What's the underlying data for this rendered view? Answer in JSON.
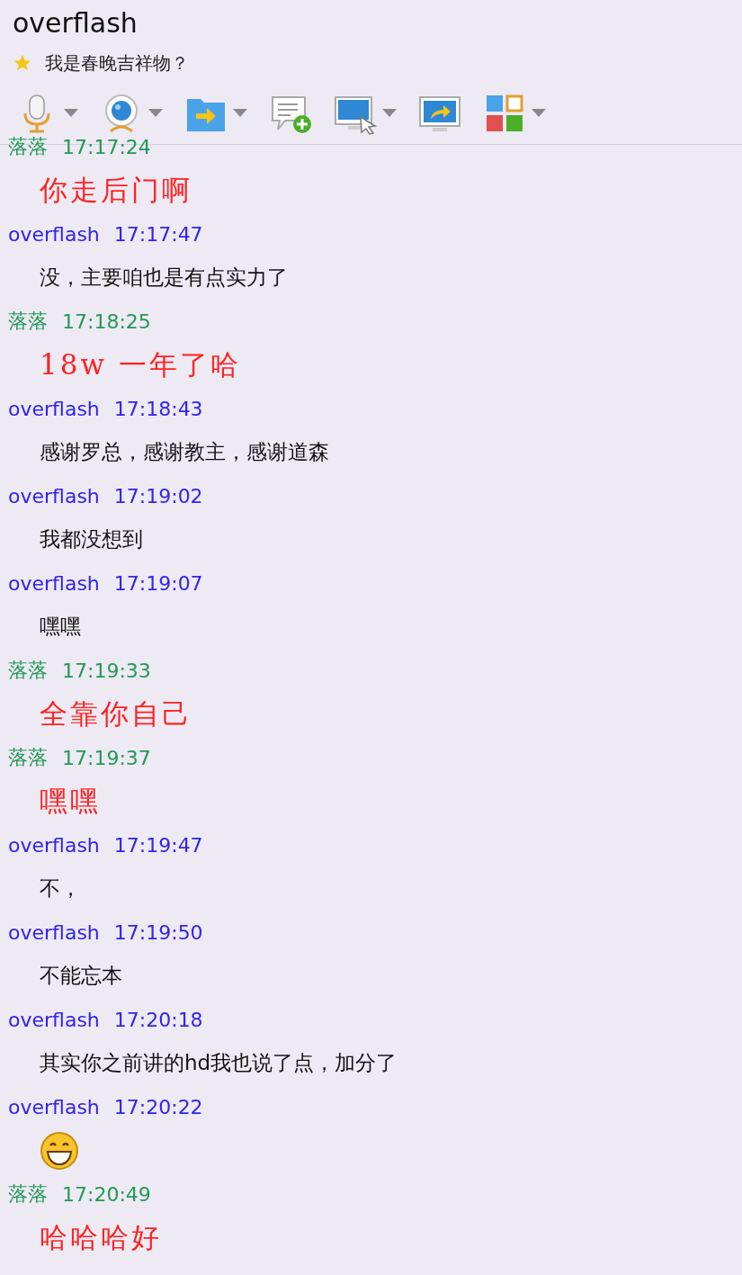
{
  "window": {
    "title": "overflash"
  },
  "status": {
    "text": "我是春晚吉祥物？"
  },
  "toolbar": [
    {
      "kind": "mic",
      "has_menu": true
    },
    {
      "kind": "camera",
      "has_menu": true
    },
    {
      "kind": "folder",
      "has_menu": true
    },
    {
      "kind": "chat-add",
      "has_menu": false
    },
    {
      "kind": "screen-pointer",
      "has_menu": true
    },
    {
      "kind": "screen-share",
      "has_menu": false
    },
    {
      "kind": "apps",
      "has_menu": true
    }
  ],
  "messages": [
    {
      "sender": "落落",
      "time": "17:17:24",
      "self": false,
      "kind": "text",
      "text": "你走后门啊"
    },
    {
      "sender": "overflash",
      "time": "17:17:47",
      "self": true,
      "kind": "text",
      "text": "没，主要咱也是有点实力了"
    },
    {
      "sender": "落落",
      "time": "17:18:25",
      "self": false,
      "kind": "text",
      "text": "18w 一年了哈"
    },
    {
      "sender": "overflash",
      "time": "17:18:43",
      "self": true,
      "kind": "text",
      "text": "感谢罗总，感谢教主，感谢道森"
    },
    {
      "sender": "overflash",
      "time": "17:19:02",
      "self": true,
      "kind": "text",
      "text": "我都没想到"
    },
    {
      "sender": "overflash",
      "time": "17:19:07",
      "self": true,
      "kind": "text",
      "text": "嘿嘿"
    },
    {
      "sender": "落落",
      "time": "17:19:33",
      "self": false,
      "kind": "text",
      "text": "全靠你自己"
    },
    {
      "sender": "落落",
      "time": "17:19:37",
      "self": false,
      "kind": "text",
      "text": "嘿嘿"
    },
    {
      "sender": "overflash",
      "time": "17:19:47",
      "self": true,
      "kind": "text",
      "text": "不，"
    },
    {
      "sender": "overflash",
      "time": "17:19:50",
      "self": true,
      "kind": "text",
      "text": "不能忘本"
    },
    {
      "sender": "overflash",
      "time": "17:20:18",
      "self": true,
      "kind": "text",
      "text": "其实你之前讲的hd我也说了点，加分了"
    },
    {
      "sender": "overflash",
      "time": "17:20:22",
      "self": true,
      "kind": "emoji"
    },
    {
      "sender": "落落",
      "time": "17:20:49",
      "self": false,
      "kind": "text",
      "text": "哈哈哈好"
    }
  ]
}
